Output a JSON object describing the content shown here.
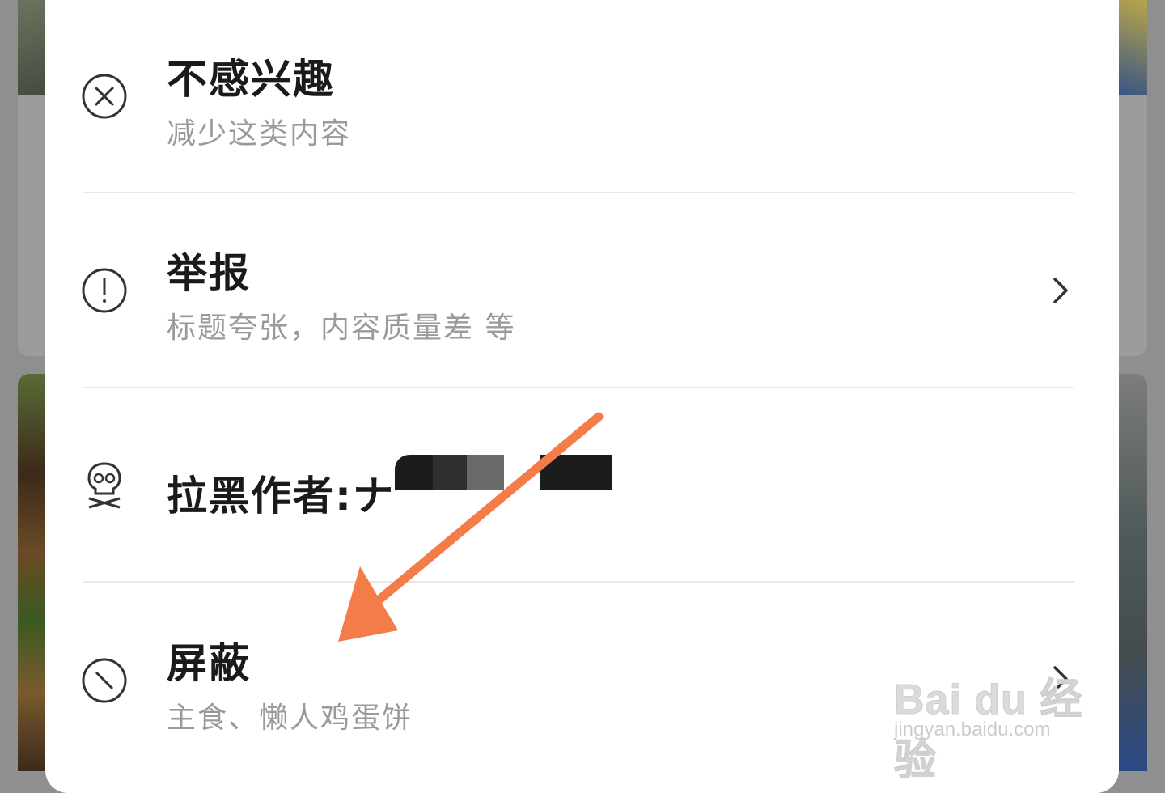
{
  "menu": {
    "items": [
      {
        "title": "不感兴趣",
        "subtitle": "减少这类内容",
        "icon": "close-circle-icon"
      },
      {
        "title": "举报",
        "subtitle": "标题夸张，内容质量差 等",
        "icon": "exclamation-circle-icon",
        "chevron": "chevron-right-icon"
      },
      {
        "title": "拉黑作者:ナ",
        "subtitle": "",
        "icon": "skull-icon"
      },
      {
        "title": "屏蔽",
        "subtitle": "主食、懒人鸡蛋饼",
        "icon": "block-circle-icon",
        "chevron": "chevron-right-icon"
      }
    ]
  },
  "annotation": {
    "arrow_color": "#f47c48"
  },
  "watermark": {
    "logo": "Bai du 经验",
    "url": "jingyan.baidu.com"
  }
}
